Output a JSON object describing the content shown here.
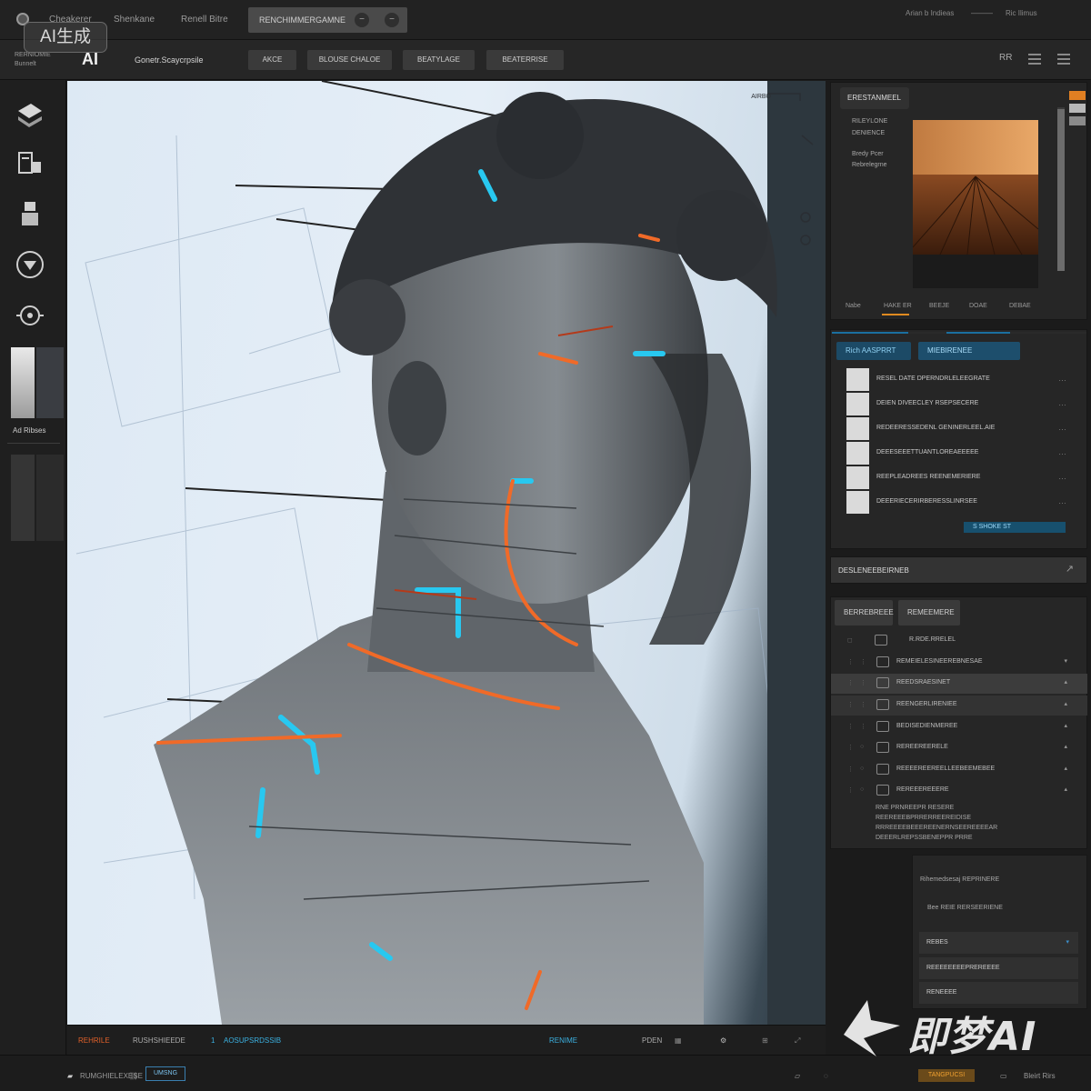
{
  "watermark_top": "AI生成",
  "watermark_brand": "即梦AI",
  "topbar": {
    "menu": [
      "Cheakerer",
      "Shenkane",
      "Renell Bitre"
    ],
    "search_box_label": "RENCHIMMERGAMNE",
    "btn_minus": "−",
    "btn_minus2": "−",
    "right": [
      "Arian b Indieas",
      "———",
      "Ric Ilimus"
    ]
  },
  "brand": {
    "line1": "RERNIOMIE",
    "line2": "Bunnelt",
    "ai": "AI"
  },
  "toolbar": {
    "subtitle": "Gonetr.Scaycrpsile",
    "buttons": [
      "AKCE",
      "BLOUSE CHALOE",
      "BEATYLAGE",
      "BEATERRISE"
    ],
    "right_label": "RR"
  },
  "rail": {
    "label": "Ad Ribses"
  },
  "canvas": {
    "tag": "AIRBO"
  },
  "status": {
    "left": "REHRILE",
    "mid": "RUSHSHIEEDE",
    "num": "1",
    "name": "AOSUPSRDSSIB",
    "center": "RENIME",
    "ind": "PDEN"
  },
  "bottombar": {
    "left": "RUMGHIELEXESE",
    "tag": "UMSNG",
    "tag_orange": "TANGPUCSI",
    "right": "Bleirt Rirs"
  },
  "panel_preview": {
    "tab": "ERESTANMEEL",
    "labels": [
      "RILEYLONE",
      "DENIENCE",
      "Bredy  Pcer",
      "Rebrelegrne"
    ],
    "tabs": [
      "Nabe",
      "HAKE ER",
      "BEEJE",
      "DOAE",
      "DEBAE"
    ]
  },
  "panel_files": {
    "tabs": [
      "Rich  AASPRRT",
      "MIEBIRENEE"
    ],
    "files": [
      "RESEL  DATE DPERNDRLELEEGRATE",
      "DEIEN DIVEECLEY  RSEPSECERE",
      "REDEERESSEDENL GENINERLEEL.AIE",
      "DEEESEEETTUANTLOREAEEEEE",
      "REEPLEADREES REENEMERIERE",
      "DEEERIECERIRBERESSLINRSEE"
    ],
    "action": "S  SHOKE  ST"
  },
  "panel_collapse": {
    "title": "DESLENEEBEIRNEB"
  },
  "panel_layers": {
    "tabs": [
      "BERREBREEE",
      "REMEEMERE"
    ],
    "header": "R.RDE.RRELEL",
    "rows": [
      "REMEIELESINEEREBNESAE",
      "REEDSRAESINET",
      "REENGERLIRENIEE",
      "BEDISEDIENMEREE",
      "REREEREERELE",
      "REEEEREEREELLEEBEEMEBEE",
      "REREEEREEERE"
    ],
    "notes": [
      "RNE PRNREEPR RESERE",
      "REEREEEBPRRERREEREIDISE",
      "RRREEEEBEEEREENERNSEEREEEEAR",
      "DEEERLREPSSBENEPPR PRRE"
    ]
  },
  "panel_props": {
    "line1": "Rihemedsesaj  REPRINERE",
    "line2": "Bee  REIE         RERSEERIENE",
    "rows": [
      "REBES",
      "REEEEEEEEPREREEEE",
      "RENEEEE"
    ]
  }
}
